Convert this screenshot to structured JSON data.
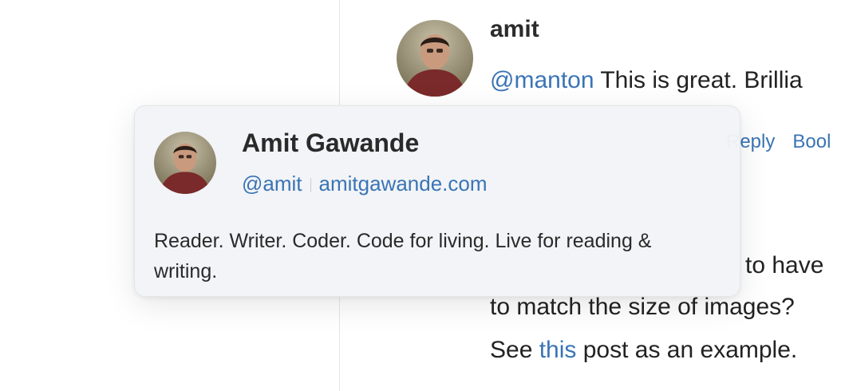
{
  "post": {
    "username": "amit",
    "line1_mention": "@manton",
    "line1_text": " This is great. Brillia",
    "line2_text": "to have",
    "line3_text": "to match the size of images?",
    "line4_pre": "See ",
    "line4_link": "this",
    "line4_post": " post as an example.",
    "actions": {
      "reply": "Reply",
      "bookmark": "Bool"
    }
  },
  "popover": {
    "name": "Amit Gawande",
    "handle": "@amit",
    "website": "amitgawande.com",
    "bio": "Reader. Writer. Coder. Code for living. Live for reading & writing."
  },
  "colors": {
    "link": "#3a74b5",
    "popover_bg": "#f2f4f7"
  }
}
